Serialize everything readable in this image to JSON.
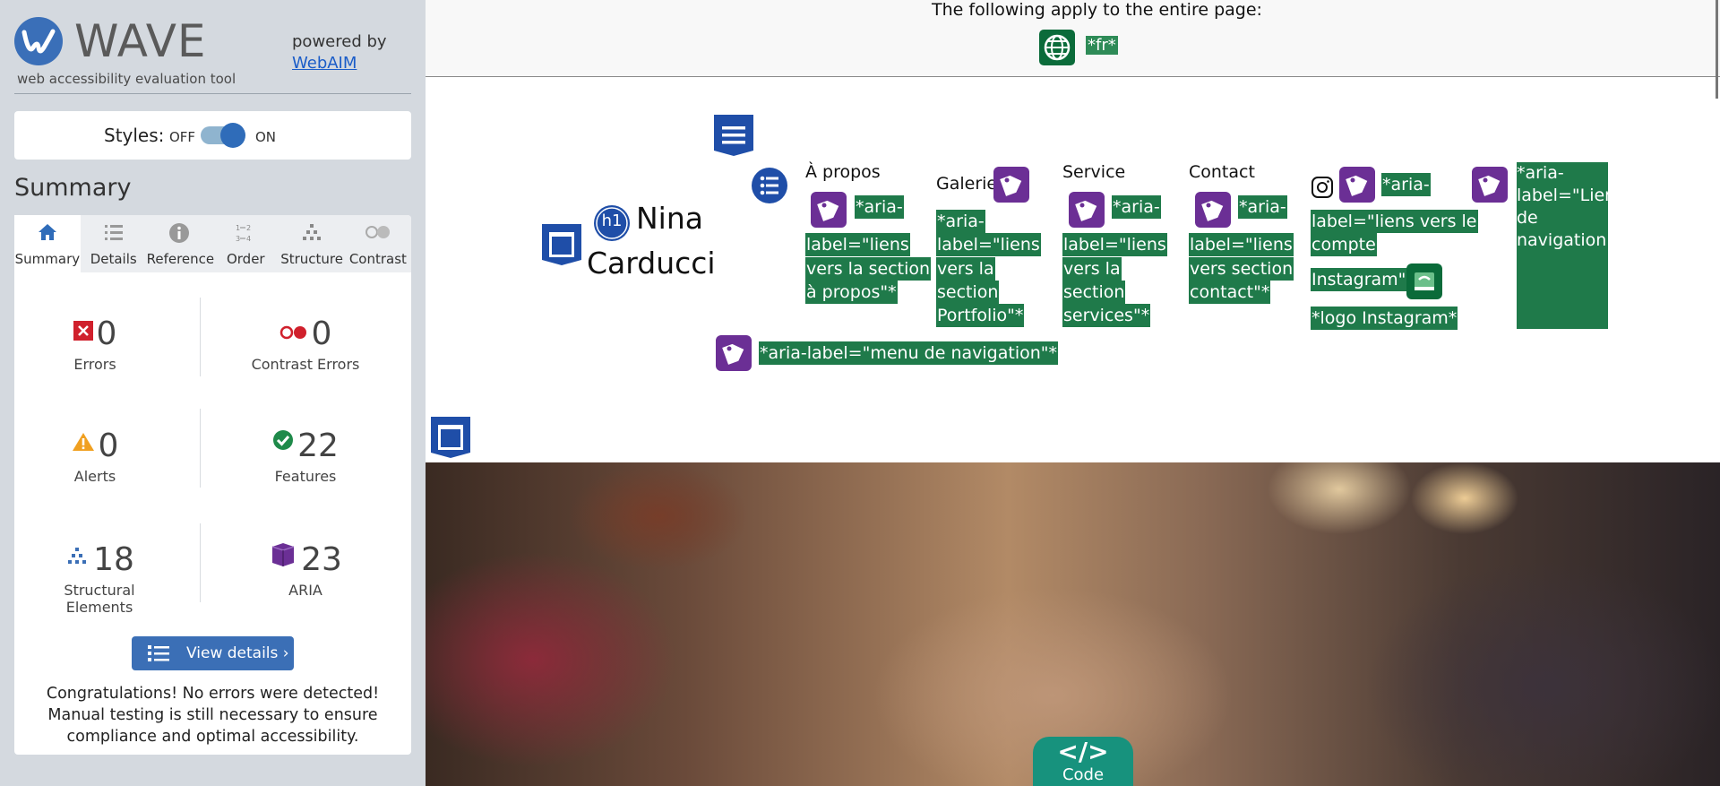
{
  "sidebar": {
    "logo_text": "WAVE",
    "logo_sub": "web accessibility evaluation tool",
    "powered_by": "powered by",
    "webaim_link": "WebAIM",
    "styles_label": "Styles:",
    "styles_off": "OFF",
    "styles_on": "ON",
    "styles_toggle_state": "on",
    "summary_title": "Summary",
    "tabs": [
      {
        "label": "Summary",
        "icon": "home-icon",
        "active": true
      },
      {
        "label": "Details",
        "icon": "list-icon",
        "active": false
      },
      {
        "label": "Reference",
        "icon": "info-icon",
        "active": false
      },
      {
        "label": "Order",
        "icon": "order-icon",
        "active": false
      },
      {
        "label": "Structure",
        "icon": "structure-icon",
        "active": false
      },
      {
        "label": "Contrast",
        "icon": "contrast-icon",
        "active": false
      }
    ],
    "stats": {
      "errors": {
        "value": "0",
        "label": "Errors",
        "icon": "error-icon"
      },
      "contrast_errors": {
        "value": "0",
        "label": "Contrast Errors",
        "icon": "contrast-error-icon"
      },
      "alerts": {
        "value": "0",
        "label": "Alerts",
        "icon": "alert-icon"
      },
      "features": {
        "value": "22",
        "label": "Features",
        "icon": "feature-check-icon"
      },
      "structural": {
        "value": "18",
        "label": "Structural Elements",
        "icon": "structure-icon"
      },
      "aria": {
        "value": "23",
        "label": "ARIA",
        "icon": "aria-cube-icon"
      }
    },
    "view_details": "View details ›",
    "congrats": "Congratulations! No errors were detected! Manual testing is still necessary to ensure compliance and optimal accessibility."
  },
  "page": {
    "entire_page_text": "The following apply to the entire page:",
    "lang_badge": "*fr*",
    "h1_badge": "h1",
    "title_line1": "Nina",
    "title_line2": "Carducci",
    "nav": {
      "apropos": "À propos",
      "galerie": "Galerie",
      "service": "Service",
      "contact": "Contact"
    },
    "labels": {
      "apropos": [
        "*aria-",
        "label=\"liens",
        "vers la section",
        "à propos\"*"
      ],
      "galerie": [
        "*aria-",
        "label=\"liens",
        "vers la",
        "section",
        "Portfolio\"*"
      ],
      "service": [
        "*aria-",
        "label=\"liens",
        "vers la",
        "section",
        "services\"*"
      ],
      "contact": [
        "*aria-",
        "label=\"liens",
        "vers section",
        "contact\"*"
      ],
      "instagram": [
        "*aria-",
        "label=\"liens vers le",
        "compte",
        "Instagram\"*"
      ],
      "logo_instagram": "*logo Instagram*",
      "nav_right": [
        "*aria-",
        "label=\"Liens",
        "de",
        "navigation\"*"
      ],
      "menu_nav": "*aria-label=\"menu de navigation\"*"
    },
    "code_button": {
      "icon": "</>",
      "label": "Code"
    }
  },
  "colors": {
    "wave_blue": "#3a6fb8",
    "aria_purple": "#6b2f95",
    "label_green": "#1f7a4a",
    "code_teal": "#17927d"
  }
}
